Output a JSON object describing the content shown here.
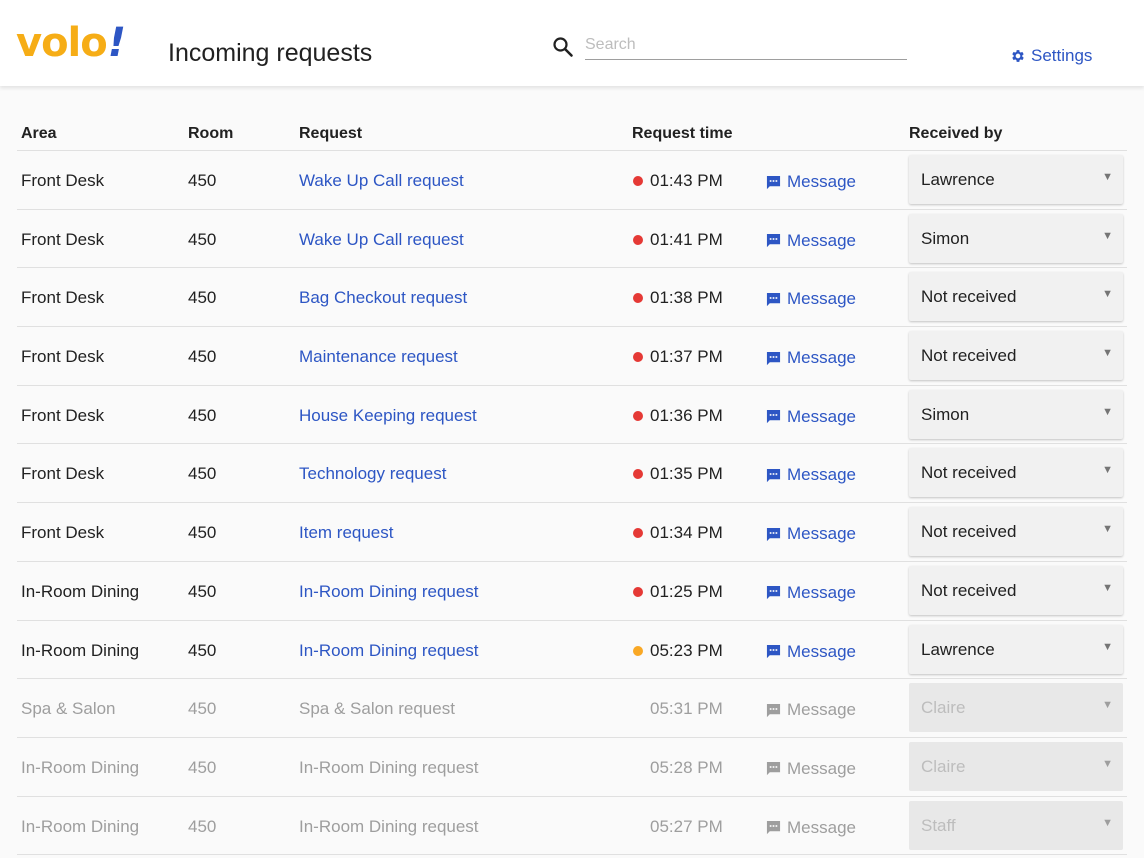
{
  "header": {
    "logo_text": "volo",
    "logo_bang": "!",
    "page_title": "Incoming requests",
    "search_placeholder": "Search",
    "search_value": "",
    "settings_label": "Settings"
  },
  "colors": {
    "brand_yellow": "#f6ad16",
    "brand_blue": "#2d56c4",
    "status_red": "#e53935",
    "status_amber": "#f9a825"
  },
  "table": {
    "columns": {
      "area": "Area",
      "room": "Room",
      "request": "Request",
      "request_time": "Request time",
      "received_by": "Received by"
    },
    "rows": [
      {
        "area": "Front Desk",
        "room": "450",
        "request": "Wake Up Call request",
        "time": "01:43 PM",
        "status": "red",
        "message": "Message",
        "received_by": "Lawrence",
        "muted": false
      },
      {
        "area": "Front Desk",
        "room": "450",
        "request": "Wake Up Call request",
        "time": "01:41 PM",
        "status": "red",
        "message": "Message",
        "received_by": "Simon",
        "muted": false
      },
      {
        "area": "Front Desk",
        "room": "450",
        "request": "Bag Checkout request",
        "time": "01:38 PM",
        "status": "red",
        "message": "Message",
        "received_by": "Not received",
        "muted": false
      },
      {
        "area": "Front Desk",
        "room": "450",
        "request": "Maintenance request",
        "time": "01:37 PM",
        "status": "red",
        "message": "Message",
        "received_by": "Not received",
        "muted": false
      },
      {
        "area": "Front Desk",
        "room": "450",
        "request": "House Keeping request",
        "time": "01:36 PM",
        "status": "red",
        "message": "Message",
        "received_by": "Simon",
        "muted": false
      },
      {
        "area": "Front Desk",
        "room": "450",
        "request": "Technology request",
        "time": "01:35 PM",
        "status": "red",
        "message": "Message",
        "received_by": "Not received",
        "muted": false
      },
      {
        "area": "Front Desk",
        "room": "450",
        "request": "Item request",
        "time": "01:34 PM",
        "status": "red",
        "message": "Message",
        "received_by": "Not received",
        "muted": false
      },
      {
        "area": "In-Room Dining",
        "room": "450",
        "request": "In-Room Dining request",
        "time": "01:25 PM",
        "status": "red",
        "message": "Message",
        "received_by": "Not received",
        "muted": false
      },
      {
        "area": "In-Room Dining",
        "room": "450",
        "request": "In-Room Dining request",
        "time": "05:23 PM",
        "status": "amber",
        "message": "Message",
        "received_by": "Lawrence",
        "muted": false
      },
      {
        "area": "Spa & Salon",
        "room": "450",
        "request": "Spa & Salon request",
        "time": "05:31 PM",
        "status": "none",
        "message": "Message",
        "received_by": "Claire",
        "muted": true
      },
      {
        "area": "In-Room Dining",
        "room": "450",
        "request": "In-Room Dining request",
        "time": "05:28 PM",
        "status": "none",
        "message": "Message",
        "received_by": "Claire",
        "muted": true
      },
      {
        "area": "In-Room Dining",
        "room": "450",
        "request": "In-Room Dining request",
        "time": "05:27 PM",
        "status": "none",
        "message": "Message",
        "received_by": "Staff",
        "muted": true
      }
    ]
  }
}
